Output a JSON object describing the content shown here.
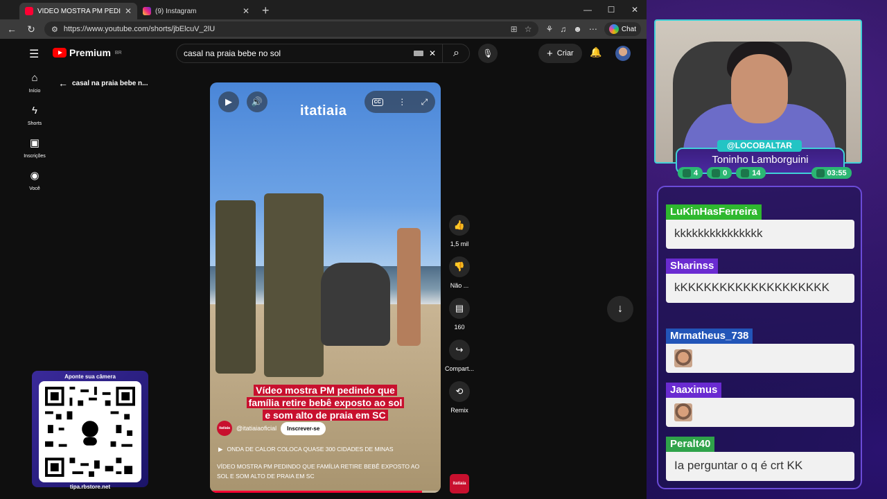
{
  "browser": {
    "tabs": [
      {
        "title": "VÍDEO MOSTRA PM PEDINDO QU",
        "favicon_color": "#ff0033",
        "active": true
      },
      {
        "title": "(9) Instagram",
        "favicon_color": "#d62976",
        "active": false
      }
    ],
    "url": "https://www.youtube.com/shorts/jbElcuV_2lU",
    "chat_label": "Chat"
  },
  "youtube": {
    "logo_text": "Premium",
    "region": "BR",
    "search_value": "casal na praia bebe no sol",
    "create_label": "Criar",
    "sidebar": [
      {
        "label": "Início",
        "icon": "home-icon"
      },
      {
        "label": "Shorts",
        "icon": "shorts-icon"
      },
      {
        "label": "Inscrições",
        "icon": "subscriptions-icon"
      },
      {
        "label": "Você",
        "icon": "you-icon"
      }
    ],
    "back_label": "casal na praia bebe n...",
    "short": {
      "watermark": "itatiaia",
      "caption_lines": [
        "Vídeo mostra PM pedindo que",
        "família retire bebê exposto ao sol",
        "e som alto de praia em SC"
      ],
      "channel_logo_text": "itatiaia",
      "channel": "@itatiaiaoficial",
      "subscribe_label": "Inscrever-se",
      "song": "ONDA DE CALOR COLOCA QUASE 300 CIDADES DE MINAS",
      "description": "VÍDEO MOSTRA PM PEDINDO QUE FAMÍLIA RETIRE BEBÊ EXPOSTO AO SOL E SOM ALTO DE PRAIA EM SC",
      "progress": 0.92
    },
    "actions": [
      {
        "label": "1,5 mil",
        "icon": "like-icon"
      },
      {
        "label": "Não ...",
        "icon": "dislike-icon"
      },
      {
        "label": "160",
        "icon": "comment-icon"
      },
      {
        "label": "Compart...",
        "icon": "share-icon"
      },
      {
        "label": "Remix",
        "icon": "remix-icon"
      }
    ]
  },
  "qr": {
    "top_text": "Aponte sua câmera",
    "bottom_text": "tipa.rbstore.net"
  },
  "streamer": {
    "handle": "@LOCOBALTAR",
    "name": "Toninho Lamborguini",
    "stats": [
      {
        "value": "4",
        "color": "#2bb673"
      },
      {
        "value": "0",
        "color": "#2bb673"
      },
      {
        "value": "14",
        "color": "#2bb673"
      },
      {
        "value": "03:55",
        "color": "#2bb673"
      }
    ]
  },
  "chat": [
    {
      "user": "LuKinHasFerreira",
      "color": "#2fb82f",
      "text": "kkkkkkkkkkkkkkk",
      "emote": false
    },
    {
      "user": "Sharinss",
      "color": "#6a2bd1",
      "text": "kKKKKKKKKKKKKKKKKKKK",
      "emote": false
    },
    {
      "user": "Mrmatheus_738",
      "color": "#2255b8",
      "text": "",
      "emote": true
    },
    {
      "user": "Jaaximus",
      "color": "#6a2bd1",
      "text": "",
      "emote": true
    },
    {
      "user": "Peralt40",
      "color": "#2fa34a",
      "text": "Ia perguntar o q é crt KK",
      "emote": false
    }
  ]
}
